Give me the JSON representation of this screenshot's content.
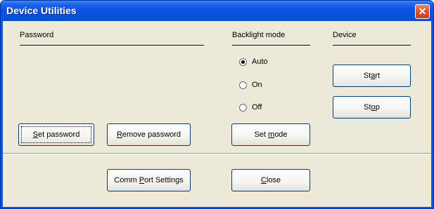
{
  "window": {
    "title": "Device Utilities",
    "close_glyph": "✕"
  },
  "sections": {
    "password": "Password",
    "backlight": "Backlight mode",
    "device": "Device"
  },
  "backlight_modes": [
    {
      "label": "Auto",
      "checked": true
    },
    {
      "label": "On",
      "checked": false
    },
    {
      "label": "Off",
      "checked": false
    }
  ],
  "buttons": {
    "set_password": {
      "pre": "",
      "mnemonic": "S",
      "post": "et password"
    },
    "remove_password": {
      "pre": "",
      "mnemonic": "R",
      "post": "emove password"
    },
    "set_mode": {
      "pre": "Set ",
      "mnemonic": "m",
      "post": "ode"
    },
    "start": {
      "pre": "St",
      "mnemonic": "a",
      "post": "rt"
    },
    "stop": {
      "pre": "St",
      "mnemonic": "o",
      "post": "p"
    },
    "comm_port": {
      "pre": "Comm ",
      "mnemonic": "P",
      "post": "ort Settings"
    },
    "close": {
      "pre": "",
      "mnemonic": "C",
      "post": "lose"
    }
  },
  "colors": {
    "titlebar": "#0a54e3",
    "dialog_bg": "#ece9d8",
    "close_button": "#d9532f"
  }
}
